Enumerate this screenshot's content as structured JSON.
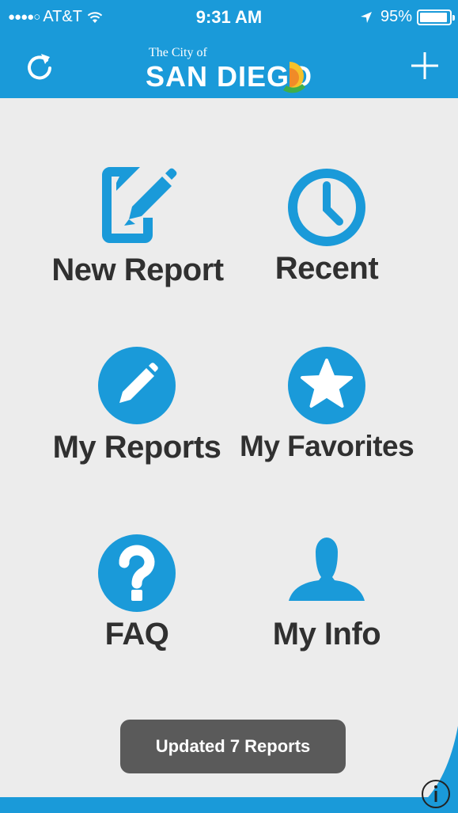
{
  "status_bar": {
    "signal": "●●●●○",
    "carrier": "AT&T",
    "time": "9:31 AM",
    "battery_percent": "95%",
    "battery_level": 0.95
  },
  "header": {
    "logo_small": "The City of",
    "logo_big": "SAN DIEGO"
  },
  "tiles": {
    "new_report": "New Report",
    "recent": "Recent",
    "my_reports": "My Reports",
    "my_favorites": "My Favorites",
    "faq": "FAQ",
    "my_info": "My Info"
  },
  "toast": "Updated 7 Reports",
  "colors": {
    "brand_blue": "#1a9ad9",
    "background": "#ececec",
    "label_text": "#303030",
    "toast_bg": "#5a5a5a"
  },
  "icons": [
    "refresh-icon",
    "plus-icon",
    "edit-document-icon",
    "clock-icon",
    "pencil-icon",
    "star-icon",
    "question-icon",
    "person-icon",
    "info-icon"
  ]
}
